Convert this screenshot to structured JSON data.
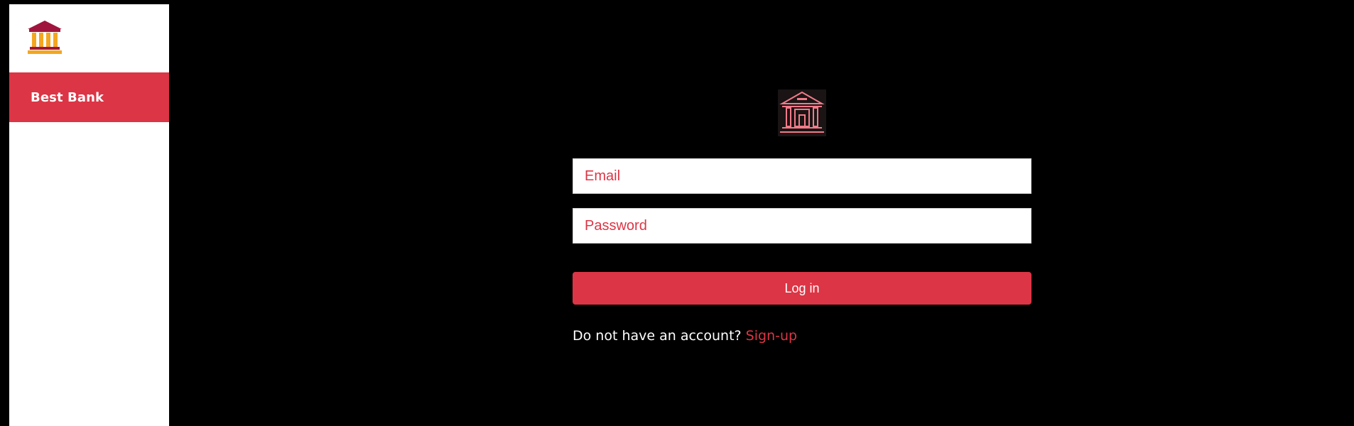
{
  "colors": {
    "accent": "#dc3545",
    "background": "#000000",
    "sidebar_background": "#ffffff",
    "logo_roof": "#a0153e",
    "logo_columns": "#f4a620"
  },
  "sidebar": {
    "logo_icon": "bank-icon",
    "brand_label": "Best Bank"
  },
  "login": {
    "logo_icon": "neon-bank-icon",
    "email": {
      "placeholder": "Email",
      "value": ""
    },
    "password": {
      "placeholder": "Password",
      "value": ""
    },
    "submit_label": "Log in",
    "signup_prompt": "Do not have an account?",
    "signup_link": "Sign-up"
  }
}
